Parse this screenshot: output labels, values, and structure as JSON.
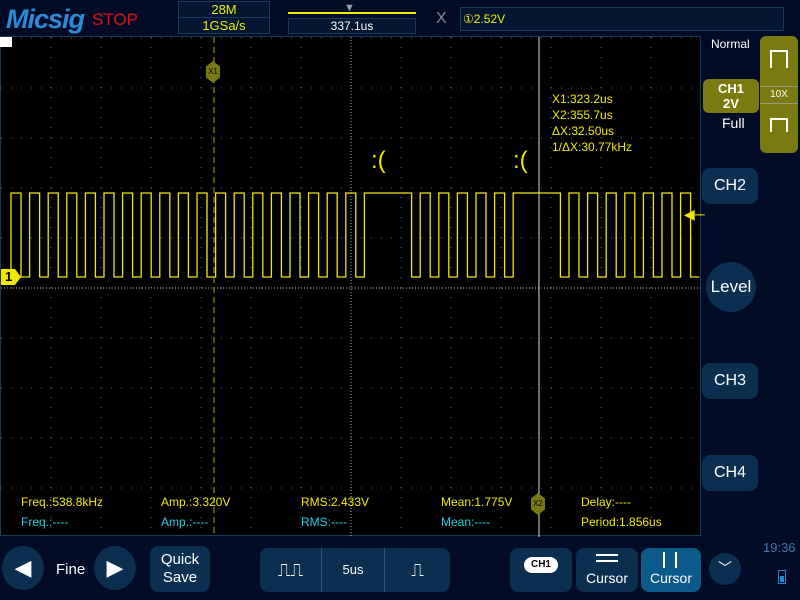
{
  "header": {
    "brand": "Micsig",
    "status": "STOP",
    "memory": "28M",
    "sample_rate": "1GSa/s",
    "trigger_position": "337.1us",
    "trigger_level": "①2.52V"
  },
  "trigger": {
    "mode": "Normal",
    "channel": "CH1",
    "scale": "2V",
    "bandwidth": "Full",
    "probe": "10X"
  },
  "channels": [
    "CH2",
    "CH3",
    "CH4"
  ],
  "level_label": "Level",
  "channel_marker": "1",
  "cursors": {
    "x1_tag": "X1",
    "x2_tag": "X2",
    "x1": "X1:323.2us",
    "x2": "X2:355.7us",
    "dx": "ΔX:32.50us",
    "inv_dx": "1/ΔX:30.77kHz"
  },
  "glitch_marks": [
    ":(",
    ":("
  ],
  "measurements": {
    "row1": [
      "Freq.:538.8kHz",
      "Amp.:3.320V",
      "RMS:2.433V",
      "Mean:1.775V",
      "Delay:----"
    ],
    "row2": [
      "Freq.:----",
      "Amp.:----",
      "RMS:----",
      "Mean:----",
      "Period:1.856us"
    ]
  },
  "toolbar": {
    "fine": "Fine",
    "quick_save": [
      "Quick",
      "Save"
    ],
    "timebase": "5us",
    "ch1": "CH1",
    "cursor_h": "Cursor",
    "cursor_v": "Cursor"
  },
  "status": {
    "time": "19:36"
  },
  "colors": {
    "ch1": "#f0e800",
    "accent": "#0b5a8a",
    "panel": "#0b2f50"
  }
}
